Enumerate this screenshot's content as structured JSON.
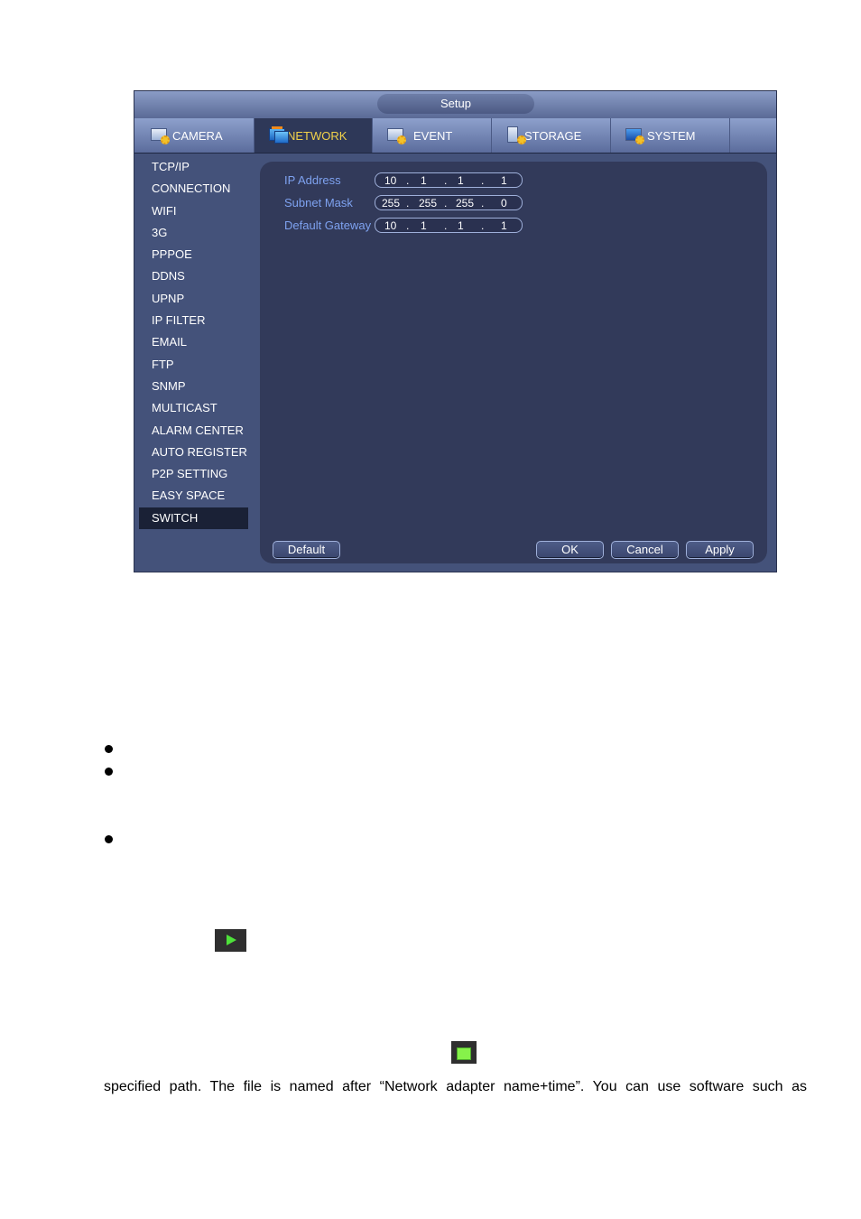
{
  "window": {
    "title": "Setup"
  },
  "tabs": [
    {
      "label": "CAMERA",
      "icon": "camera-settings-icon",
      "active": false
    },
    {
      "label": "NETWORK",
      "icon": "network-icon",
      "active": true
    },
    {
      "label": "EVENT",
      "icon": "event-settings-icon",
      "active": false
    },
    {
      "label": "STORAGE",
      "icon": "storage-settings-icon",
      "active": false
    },
    {
      "label": "SYSTEM",
      "icon": "system-settings-icon",
      "active": false
    }
  ],
  "sidebar": {
    "items": [
      {
        "label": "TCP/IP"
      },
      {
        "label": "CONNECTION"
      },
      {
        "label": "WIFI"
      },
      {
        "label": "3G"
      },
      {
        "label": "PPPOE"
      },
      {
        "label": "DDNS"
      },
      {
        "label": "UPNP"
      },
      {
        "label": "IP FILTER"
      },
      {
        "label": "EMAIL"
      },
      {
        "label": "FTP"
      },
      {
        "label": "SNMP"
      },
      {
        "label": "MULTICAST"
      },
      {
        "label": "ALARM CENTER"
      },
      {
        "label": "AUTO REGISTER"
      },
      {
        "label": "P2P SETTING"
      },
      {
        "label": "EASY SPACE"
      },
      {
        "label": "SWITCH"
      }
    ],
    "active": "SWITCH"
  },
  "form": {
    "ip_address": {
      "label": "IP Address",
      "octets": [
        "10",
        "1",
        "1",
        "1"
      ]
    },
    "subnet_mask": {
      "label": "Subnet Mask",
      "octets": [
        "255",
        "255",
        "255",
        "0"
      ]
    },
    "default_gateway": {
      "label": "Default Gateway",
      "octets": [
        "10",
        "1",
        "1",
        "1"
      ]
    }
  },
  "buttons": {
    "default": "Default",
    "ok": "OK",
    "cancel": "Cancel",
    "apply": "Apply"
  },
  "document": {
    "icons": [
      "play-icon",
      "stop-icon"
    ],
    "text": "specified path. The file is named after “Network adapter name+time”. You can use software such as"
  }
}
